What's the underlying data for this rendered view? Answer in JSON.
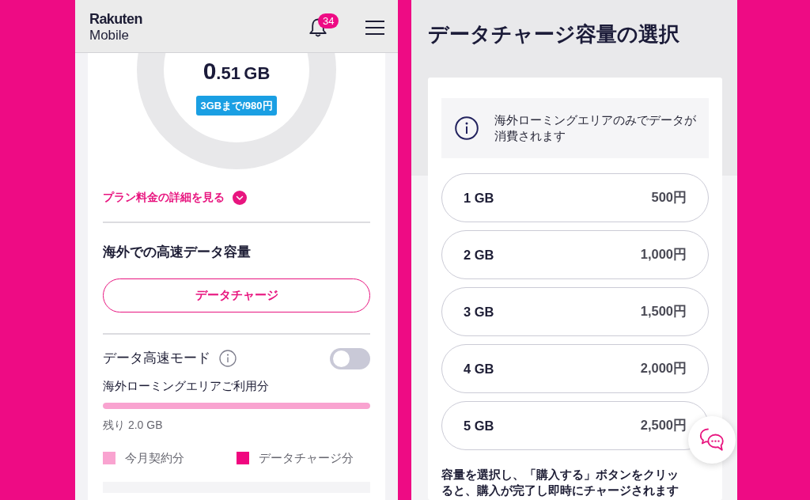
{
  "left_screen": {
    "header": {
      "logo": {
        "line_1": "Rakuten",
        "line_2": "Mobile"
      },
      "notification_count": "34"
    },
    "usage": {
      "whole": "0",
      "fraction": ".51",
      "unit": "GB",
      "plan_badge": "3GBまで/980円"
    },
    "plan_details_link": "プラン料金の詳細を見る",
    "section_title": "海外での高速データ容量",
    "charge_button": "データチャージ",
    "high_speed_mode": {
      "label": "データ高速モード",
      "on": false
    },
    "roaming_usage": {
      "label": "海外ローミングエリアご利用分",
      "level": 1,
      "remaining": "残り 2.0 GB"
    },
    "legend": [
      {
        "label": "今月契約分",
        "color": "#f9a3d0"
      },
      {
        "label": "データチャージ分",
        "color": "#f0077f"
      }
    ]
  },
  "right_screen": {
    "title": "データチャージ容量の選択",
    "notice": "海外ローミングエリアのみでデータが消費されます",
    "options": [
      {
        "amount": "1 GB",
        "price": "500円",
        "selected": false
      },
      {
        "amount": "2 GB",
        "price": "1,000円",
        "selected": false
      },
      {
        "amount": "3 GB",
        "price": "1,500円",
        "selected": false
      },
      {
        "amount": "4 GB",
        "price": "2,000円",
        "selected": false
      },
      {
        "amount": "5 GB",
        "price": "2,500円",
        "selected": false
      }
    ],
    "note_lines": [
      "容量を選択し、「購入する」ボタンをクリッ",
      "ると、購入が完了し即時にチャージされます"
    ]
  }
}
